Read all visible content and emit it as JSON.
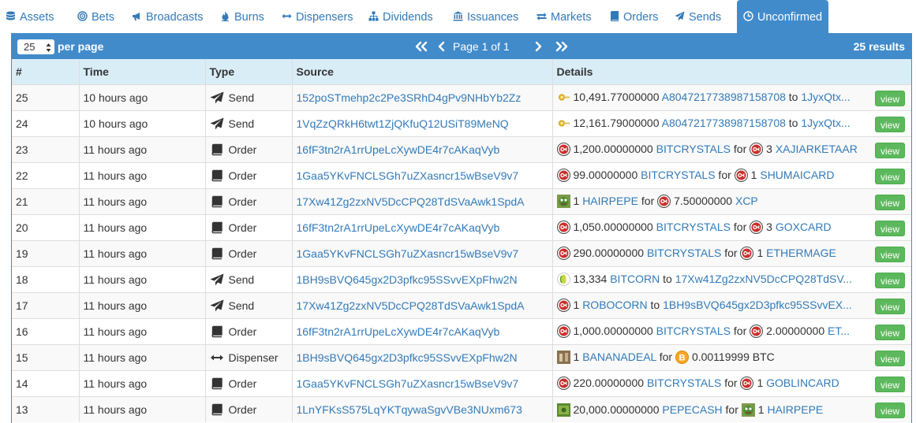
{
  "tabs": [
    {
      "label": "Assets",
      "icon": "database-icon",
      "active": false
    },
    {
      "label": "Bets",
      "icon": "bullseye-icon",
      "active": false
    },
    {
      "label": "Broadcasts",
      "icon": "bullhorn-icon",
      "active": false
    },
    {
      "label": "Burns",
      "icon": "fire-icon",
      "active": false
    },
    {
      "label": "Dispensers",
      "icon": "arrows-h-icon",
      "active": false
    },
    {
      "label": "Dividends",
      "icon": "sitemap-icon",
      "active": false
    },
    {
      "label": "Issuances",
      "icon": "bank-icon",
      "active": false
    },
    {
      "label": "Markets",
      "icon": "exchange-icon",
      "active": false
    },
    {
      "label": "Orders",
      "icon": "book-icon",
      "active": false
    },
    {
      "label": "Sends",
      "icon": "paper-plane-icon",
      "active": false
    },
    {
      "label": "Unconfirmed",
      "icon": "clock-icon",
      "active": true
    }
  ],
  "header": {
    "per_page_value": "25",
    "per_page_label": "per page",
    "page_text": "Page 1 of 1",
    "results": "25 results"
  },
  "columns": [
    "#",
    "Time",
    "Type",
    "Source",
    "Details"
  ],
  "view_label": "view",
  "colors": {
    "primary": "#428bca",
    "link": "#337ab7",
    "success": "#5cb85c",
    "header_row": "#d9edf7"
  },
  "rows": [
    {
      "num": "25",
      "time": "10 hours ago",
      "type": "Send",
      "type_icon": "paper-plane-icon",
      "source": "152poSTmehp2c2Pe3SRhD4gPv9NHbYb2Zz",
      "details": [
        {
          "icon": "key-token-icon"
        },
        {
          "t": "10,491.77000000 "
        },
        {
          "l": "A8047217738987158708"
        },
        {
          "t": " to "
        },
        {
          "l": "1JyxQtx..."
        }
      ]
    },
    {
      "num": "24",
      "time": "10 hours ago",
      "type": "Send",
      "type_icon": "paper-plane-icon",
      "source": "1VqZzQRkH6twt1ZjQKfuQ12USiT89MeNQ",
      "details": [
        {
          "icon": "key-token-icon"
        },
        {
          "t": "12,161.79000000 "
        },
        {
          "l": "A8047217738987158708"
        },
        {
          "t": " to "
        },
        {
          "l": "1JyxQtx..."
        }
      ]
    },
    {
      "num": "23",
      "time": "11 hours ago",
      "type": "Order",
      "type_icon": "book-icon",
      "source": "16fF3tn2rA1rrUpeLcXywDE4r7cAKaqVyb",
      "details": [
        {
          "icon": "bitcrystals-icon"
        },
        {
          "t": "1,200.00000000 "
        },
        {
          "l": "BITCRYSTALS"
        },
        {
          "t": " for "
        },
        {
          "icon": "bitcrystals-icon"
        },
        {
          "t": "3 "
        },
        {
          "l": "XAJIARKETAAR"
        }
      ]
    },
    {
      "num": "22",
      "time": "11 hours ago",
      "type": "Order",
      "type_icon": "book-icon",
      "source": "1Gaa5YKvFNCLSGh7uZXasncr15wBseV9v7",
      "details": [
        {
          "icon": "bitcrystals-icon"
        },
        {
          "t": "99.00000000 "
        },
        {
          "l": "BITCRYSTALS"
        },
        {
          "t": " for "
        },
        {
          "icon": "bitcrystals-icon"
        },
        {
          "t": "1 "
        },
        {
          "l": "SHUMAICARD"
        }
      ]
    },
    {
      "num": "21",
      "time": "11 hours ago",
      "type": "Order",
      "type_icon": "book-icon",
      "source": "17Xw41Zg2zxNV5DcCPQ28TdSVaAwk1SpdA",
      "details": [
        {
          "icon": "pepe-icon"
        },
        {
          "t": "1 "
        },
        {
          "l": "HAIRPEPE"
        },
        {
          "t": " for "
        },
        {
          "icon": "bitcrystals-icon"
        },
        {
          "t": "7.50000000 "
        },
        {
          "l": "XCP"
        }
      ]
    },
    {
      "num": "20",
      "time": "11 hours ago",
      "type": "Order",
      "type_icon": "book-icon",
      "source": "16fF3tn2rA1rrUpeLcXywDE4r7cAKaqVyb",
      "details": [
        {
          "icon": "bitcrystals-icon"
        },
        {
          "t": "1,050.00000000 "
        },
        {
          "l": "BITCRYSTALS"
        },
        {
          "t": " for "
        },
        {
          "icon": "bitcrystals-icon"
        },
        {
          "t": "3 "
        },
        {
          "l": "GOXCARD"
        }
      ]
    },
    {
      "num": "19",
      "time": "11 hours ago",
      "type": "Order",
      "type_icon": "book-icon",
      "source": "1Gaa5YKvFNCLSGh7uZXasncr15wBseV9v7",
      "details": [
        {
          "icon": "bitcrystals-icon"
        },
        {
          "t": "290.00000000 "
        },
        {
          "l": "BITCRYSTALS"
        },
        {
          "t": " for "
        },
        {
          "icon": "bitcrystals-icon"
        },
        {
          "t": "1 "
        },
        {
          "l": "ETHERMAGE"
        }
      ]
    },
    {
      "num": "18",
      "time": "11 hours ago",
      "type": "Send",
      "type_icon": "paper-plane-icon",
      "source": "1BH9sBVQ645gx2D3pfkc95SSvvEXpFhw2N",
      "details": [
        {
          "icon": "bitcorn-icon"
        },
        {
          "t": "13,334 "
        },
        {
          "l": "BITCORN"
        },
        {
          "t": " to "
        },
        {
          "l": "17Xw41Zg2zxNV5DcCPQ28TdSV..."
        }
      ]
    },
    {
      "num": "17",
      "time": "11 hours ago",
      "type": "Send",
      "type_icon": "paper-plane-icon",
      "source": "17Xw41Zg2zxNV5DcCPQ28TdSVaAwk1SpdA",
      "details": [
        {
          "icon": "bitcrystals-icon"
        },
        {
          "t": "1 "
        },
        {
          "l": "ROBOCORN"
        },
        {
          "t": " to "
        },
        {
          "l": "1BH9sBVQ645gx2D3pfkc95SSvvEX..."
        }
      ]
    },
    {
      "num": "16",
      "time": "11 hours ago",
      "type": "Order",
      "type_icon": "book-icon",
      "source": "16fF3tn2rA1rrUpeLcXywDE4r7cAKaqVyb",
      "details": [
        {
          "icon": "bitcrystals-icon"
        },
        {
          "t": "1,000.00000000 "
        },
        {
          "l": "BITCRYSTALS"
        },
        {
          "t": " for "
        },
        {
          "icon": "bitcrystals-icon"
        },
        {
          "t": "2.00000000 "
        },
        {
          "l": "ET..."
        }
      ]
    },
    {
      "num": "15",
      "time": "11 hours ago",
      "type": "Dispenser",
      "type_icon": "arrows-h-icon",
      "source": "1BH9sBVQ645gx2D3pfkc95SSvvEXpFhw2N",
      "details": [
        {
          "icon": "bananadeal-icon"
        },
        {
          "t": "1 "
        },
        {
          "l": "BANANADEAL"
        },
        {
          "t": " for "
        },
        {
          "icon": "bitcoin-icon"
        },
        {
          "t": "0.00119999 BTC"
        }
      ]
    },
    {
      "num": "14",
      "time": "11 hours ago",
      "type": "Order",
      "type_icon": "book-icon",
      "source": "1Gaa5YKvFNCLSGh7uZXasncr15wBseV9v7",
      "details": [
        {
          "icon": "bitcrystals-icon"
        },
        {
          "t": "220.00000000 "
        },
        {
          "l": "BITCRYSTALS"
        },
        {
          "t": " for "
        },
        {
          "icon": "bitcrystals-icon"
        },
        {
          "t": "1 "
        },
        {
          "l": "GOBLINCARD"
        }
      ]
    },
    {
      "num": "13",
      "time": "11 hours ago",
      "type": "Order",
      "type_icon": "book-icon",
      "source": "1LnYFKsS575LqYKTqywaSgvVBe3NUxm673",
      "details": [
        {
          "icon": "pepecash-icon"
        },
        {
          "t": "20,000.00000000 "
        },
        {
          "l": "PEPECASH"
        },
        {
          "t": " for "
        },
        {
          "icon": "pepe-icon"
        },
        {
          "t": "1 "
        },
        {
          "l": "HAIRPEPE"
        }
      ]
    }
  ]
}
